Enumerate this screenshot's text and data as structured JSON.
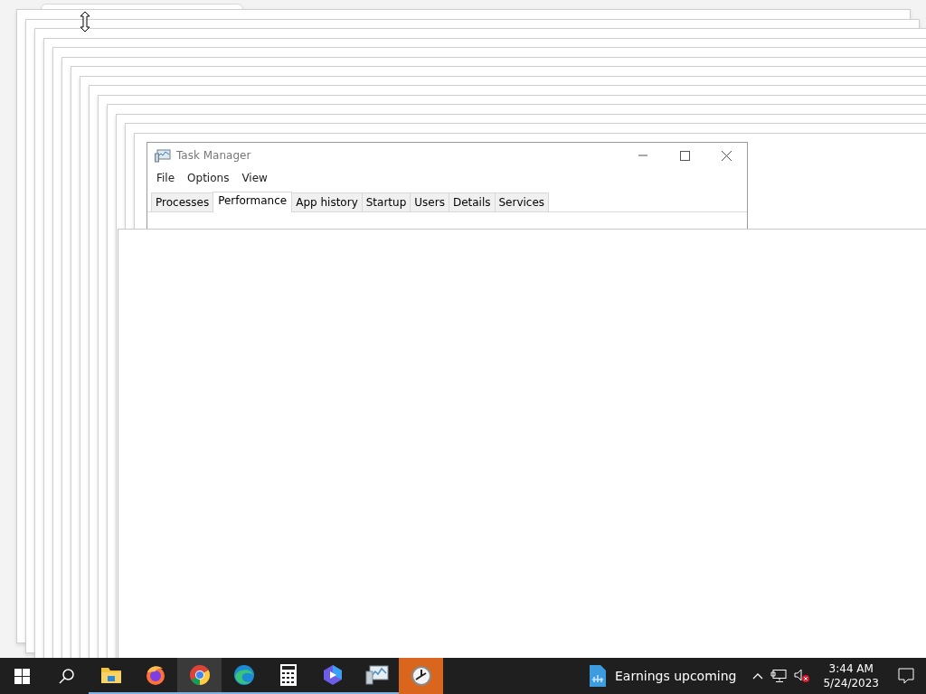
{
  "task_manager": {
    "title": "Task Manager",
    "menu": [
      "File",
      "Options",
      "View"
    ],
    "tabs": [
      {
        "label": "Processes",
        "selected": false
      },
      {
        "label": "Performance",
        "selected": true
      },
      {
        "label": "App history",
        "selected": false
      },
      {
        "label": "Startup",
        "selected": false
      },
      {
        "label": "Users",
        "selected": false
      },
      {
        "label": "Details",
        "selected": false
      },
      {
        "label": "Services",
        "selected": false
      }
    ]
  },
  "taskbar": {
    "apps": [
      {
        "kind": "explorer",
        "running": true,
        "selected": false,
        "flashing": false
      },
      {
        "kind": "firefox",
        "running": true,
        "selected": false,
        "flashing": false
      },
      {
        "kind": "chrome",
        "running": true,
        "selected": true,
        "flashing": false
      },
      {
        "kind": "edge",
        "running": true,
        "selected": false,
        "flashing": false
      },
      {
        "kind": "calculator",
        "running": true,
        "selected": false,
        "flashing": false
      },
      {
        "kind": "video",
        "running": true,
        "selected": false,
        "flashing": false
      },
      {
        "kind": "monitor",
        "running": true,
        "selected": false,
        "flashing": false
      },
      {
        "kind": "clock",
        "running": false,
        "selected": false,
        "flashing": true
      }
    ],
    "news": "Earnings upcoming",
    "time": "3:44 AM",
    "date": "5/24/2023"
  }
}
